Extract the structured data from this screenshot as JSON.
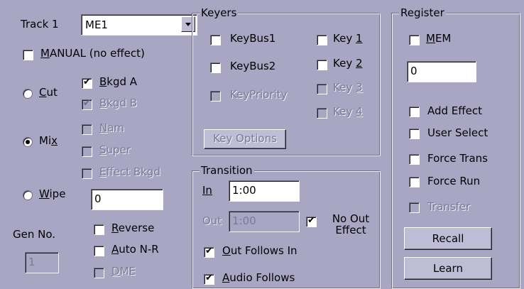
{
  "track": {
    "label": "Track 1",
    "value": "ME1",
    "icon": "chevron-down-icon"
  },
  "manual": {
    "prefix": "",
    "accel": "M",
    "rest": "ANUAL (no effect)",
    "checked": false
  },
  "modes": [
    {
      "prefix": "",
      "accel": "C",
      "rest": "ut",
      "selected": false
    },
    {
      "prefix": "Mi",
      "accel": "x",
      "rest": "",
      "selected": true
    },
    {
      "prefix": "",
      "accel": "W",
      "rest": "ipe",
      "selected": false
    }
  ],
  "layers": [
    {
      "accel": "B",
      "rest": "kgd A",
      "checked": true,
      "disabled": false
    },
    {
      "accel": "B",
      "rest": "kgd B",
      "checked": true,
      "disabled": true
    },
    {
      "accel": "N",
      "rest": "am",
      "checked": false,
      "disabled": true
    },
    {
      "accel": "S",
      "rest": "uper",
      "checked": false,
      "disabled": true
    },
    {
      "accel": "E",
      "rest": "ffect Bkgd",
      "checked": false,
      "disabled": true
    }
  ],
  "wipe_value": "0",
  "reverse": {
    "accel": "R",
    "rest": "everse",
    "checked": false
  },
  "auto_nr": {
    "accel": "A",
    "rest": "uto N-R",
    "checked": false
  },
  "dme": {
    "accel": "D",
    "rest": "ME",
    "checked": false,
    "disabled": true
  },
  "gen": {
    "label": "Gen No.",
    "value": "1"
  },
  "keyers": {
    "title": "Keyers",
    "keybus1": "KeyBus1",
    "keybus2": "KeyBus2",
    "keypriority": "KeyPriority",
    "keys": [
      {
        "prefix": "Key ",
        "accel": "1",
        "disabled": false
      },
      {
        "prefix": "Key ",
        "accel": "2",
        "disabled": false
      },
      {
        "prefix": "Key ",
        "accel": "3",
        "disabled": true
      },
      {
        "prefix": "Key ",
        "accel": "4",
        "disabled": true
      }
    ],
    "options_button": "Key Options"
  },
  "transition": {
    "title": "Transition",
    "in_label": "In",
    "in_value": "1:00",
    "out_label": "Out",
    "out_value": "1:00",
    "no_out_effect": "No Out Effect",
    "no_out_checked": true,
    "out_follows_in": {
      "accel": "O",
      "rest": "ut Follows In",
      "checked": true
    },
    "audio_follows": {
      "accel": "A",
      "rest": "udio Follows",
      "checked": true
    }
  },
  "register": {
    "title": "Register",
    "mem": {
      "accel": "M",
      "rest": "EM",
      "checked": false
    },
    "value": "0",
    "add_effect": "Add Effect",
    "user_select": "User Select",
    "force_trans": "Force Trans",
    "force_run": "Force Run",
    "transfer": "Transfer",
    "recall": "Recall",
    "learn": "Learn"
  },
  "colors": {
    "face": "#a9a6c4",
    "shadow": "#6e6c86",
    "highlight": "#f4f3fa"
  }
}
